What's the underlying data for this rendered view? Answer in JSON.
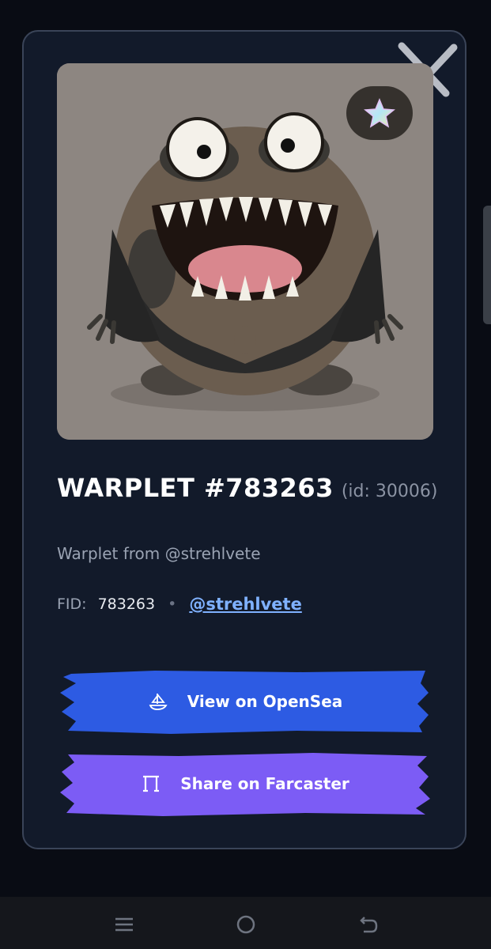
{
  "nft": {
    "name": "WARPLET #783263",
    "id_label": "(id: 30006)",
    "description": "Warplet from @strehlvete",
    "fid_label": "FID:",
    "fid_value": "783263",
    "separator": "•",
    "handle": "@strehlvete"
  },
  "actions": {
    "opensea_label": "View on OpenSea",
    "farcaster_label": "Share on Farcaster"
  },
  "colors": {
    "card_bg": "#121a2a",
    "opensea_blue": "#2d5be3",
    "farcaster_purple": "#7c5cf5",
    "link": "#7fb1ff"
  },
  "icons": [
    "close-icon",
    "star-icon",
    "opensea-boat-icon",
    "farcaster-arch-icon",
    "menu-icon",
    "home-icon",
    "back-icon"
  ]
}
